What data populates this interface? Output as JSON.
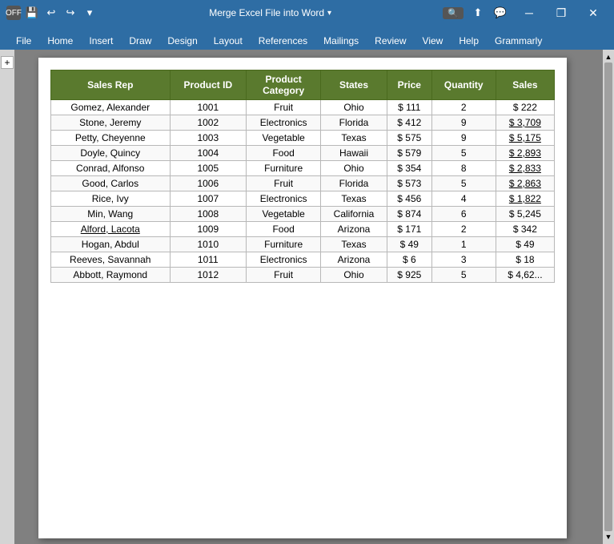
{
  "titlebar": {
    "left_icons": [
      "off",
      "save",
      "undo",
      "redo",
      "more"
    ],
    "title": "Merge Excel File into Word",
    "search_placeholder": "Search",
    "window_controls": [
      "minimize",
      "restore",
      "close"
    ]
  },
  "ribbon": {
    "tabs": [
      "File",
      "Home",
      "Insert",
      "Draw",
      "Design",
      "Layout",
      "References",
      "Mailings",
      "Review",
      "View",
      "Help",
      "Grammarly"
    ],
    "share_icon": "share",
    "feedback_icon": "feedback"
  },
  "table": {
    "headers": [
      "Sales Rep",
      "Product ID",
      "Product Category",
      "States",
      "Price",
      "Quantity",
      "Sales"
    ],
    "rows": [
      {
        "name": "Gomez, Alexander",
        "id": "1001",
        "category": "Fruit",
        "state": "Ohio",
        "price": "$ 111",
        "quantity": "2",
        "sales": "$ 222",
        "name_underline": false,
        "sales_underline": false
      },
      {
        "name": "Stone, Jeremy",
        "id": "1002",
        "category": "Electronics",
        "state": "Florida",
        "price": "$ 412",
        "quantity": "9",
        "sales": "$ 3,709",
        "name_underline": false,
        "sales_underline": true
      },
      {
        "name": "Petty, Cheyenne",
        "id": "1003",
        "category": "Vegetable",
        "state": "Texas",
        "price": "$ 575",
        "quantity": "9",
        "sales": "$ 5,175",
        "name_underline": false,
        "sales_underline": true
      },
      {
        "name": "Doyle, Quincy",
        "id": "1004",
        "category": "Food",
        "state": "Hawaii",
        "price": "$ 579",
        "quantity": "5",
        "sales": "$ 2,893",
        "name_underline": false,
        "sales_underline": true
      },
      {
        "name": "Conrad, Alfonso",
        "id": "1005",
        "category": "Furniture",
        "state": "Ohio",
        "price": "$ 354",
        "quantity": "8",
        "sales": "$ 2,833",
        "name_underline": false,
        "sales_underline": true
      },
      {
        "name": "Good, Carlos",
        "id": "1006",
        "category": "Fruit",
        "state": "Florida",
        "price": "$ 573",
        "quantity": "5",
        "sales": "$ 2,863",
        "name_underline": false,
        "sales_underline": true
      },
      {
        "name": "Rice, Ivy",
        "id": "1007",
        "category": "Electronics",
        "state": "Texas",
        "price": "$ 456",
        "quantity": "4",
        "sales": "$ 1,822",
        "name_underline": false,
        "sales_underline": true
      },
      {
        "name": "Min, Wang",
        "id": "1008",
        "category": "Vegetable",
        "state": "California",
        "price": "$ 874",
        "quantity": "6",
        "sales": "$ 5,245",
        "name_underline": false,
        "sales_underline": false
      },
      {
        "name": "Alford, Lacota",
        "id": "1009",
        "category": "Food",
        "state": "Arizona",
        "price": "$ 171",
        "quantity": "2",
        "sales": "$ 342",
        "name_underline": true,
        "sales_underline": false
      },
      {
        "name": "Hogan, Abdul",
        "id": "1010",
        "category": "Furniture",
        "state": "Texas",
        "price": "$ 49",
        "quantity": "1",
        "sales": "$ 49",
        "name_underline": false,
        "sales_underline": false
      },
      {
        "name": "Reeves, Savannah",
        "id": "1011",
        "category": "Electronics",
        "state": "Arizona",
        "price": "$ 6",
        "quantity": "3",
        "sales": "$ 18",
        "name_underline": false,
        "sales_underline": false
      },
      {
        "name": "Abbott, Raymond",
        "id": "1012",
        "category": "Fruit",
        "state": "Ohio",
        "price": "$ 925",
        "quantity": "5",
        "sales": "$ 4,62...",
        "name_underline": false,
        "sales_underline": false
      }
    ]
  },
  "ui": {
    "add_table_icon": "+",
    "scrollbar_top_arrow": "▲",
    "scrollbar_bottom_arrow": "▼",
    "minimize": "─",
    "restore": "❐",
    "close": "✕",
    "search_icon": "🔍",
    "share_icon": "⬆",
    "feedback_icon": "💬",
    "save_icon": "💾",
    "undo_icon": "↩",
    "redo_icon": "↪",
    "more_icon": "▾",
    "off_text": "OFF"
  }
}
